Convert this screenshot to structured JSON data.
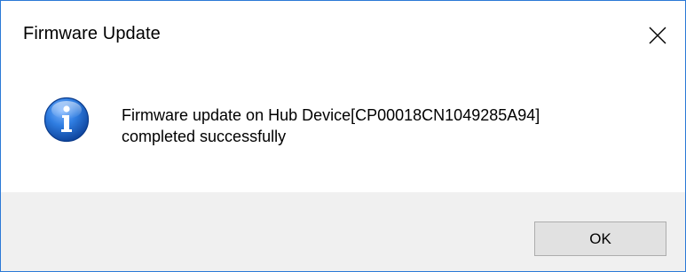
{
  "dialog": {
    "title": "Firmware Update",
    "close_icon": "close-icon",
    "info_icon": "info-icon",
    "message_line1": "Firmware update on Hub Device[CP00018CN1049285A94]",
    "message_line2": "completed successfully",
    "ok_label": "OK"
  },
  "colors": {
    "window_border": "#2b79d6",
    "footer_background": "#f0f0f0",
    "button_background": "#e1e1e1",
    "icon_blue": "#1f5fbf"
  }
}
